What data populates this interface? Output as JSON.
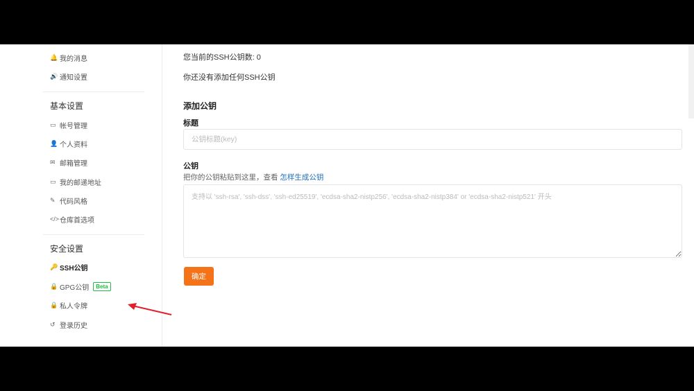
{
  "sidebar": {
    "notify_items": [
      {
        "icon": "bell-icon",
        "glyph": "🔔",
        "label": "我的消息"
      },
      {
        "icon": "speaker-icon",
        "glyph": "🔊",
        "label": "通知设置"
      }
    ],
    "basic_heading": "基本设置",
    "basic_items": [
      {
        "icon": "id-card-icon",
        "glyph": "▭",
        "label": "帐号管理"
      },
      {
        "icon": "user-icon",
        "glyph": "👤",
        "label": "个人资料"
      },
      {
        "icon": "envelope-icon",
        "glyph": "✉",
        "label": "邮箱管理"
      },
      {
        "icon": "id-card-icon",
        "glyph": "▭",
        "label": "我的邮递地址"
      },
      {
        "icon": "paintbrush-icon",
        "glyph": "✎",
        "label": "代码风格"
      },
      {
        "icon": "code-icon",
        "glyph": "</>",
        "label": "仓库首选项"
      }
    ],
    "security_heading": "安全设置",
    "security_items": [
      {
        "icon": "key-icon",
        "glyph": "🔑",
        "label": "SSH公钥",
        "active": true
      },
      {
        "icon": "lock-icon",
        "glyph": "🔒",
        "label": "GPG公钥",
        "badge": "Beta"
      },
      {
        "icon": "lock-icon",
        "glyph": "🔒",
        "label": "私人令牌"
      },
      {
        "icon": "history-icon",
        "glyph": "↺",
        "label": "登录历史"
      }
    ]
  },
  "main": {
    "ssh_count_text": "您当前的SSH公钥数: 0",
    "no_key_text": "你还没有添加任何SSH公钥",
    "add_heading": "添加公钥",
    "title_label": "标题",
    "title_placeholder": "公钥标题(key)",
    "key_label": "公钥",
    "key_hint": "把你的公钥粘贴到这里，查看",
    "key_hint_link": "怎样生成公钥",
    "key_placeholder": "支持以 'ssh-rsa', 'ssh-dss', 'ssh-ed25519', 'ecdsa-sha2-nistp256', 'ecdsa-sha2-nistp384' or 'ecdsa-sha2-nistp521' 开头",
    "submit_label": "确定"
  },
  "colors": {
    "accent": "#f47218",
    "link": "#1e70bf",
    "beta": "#21ba45",
    "arrow": "#e0202a"
  }
}
